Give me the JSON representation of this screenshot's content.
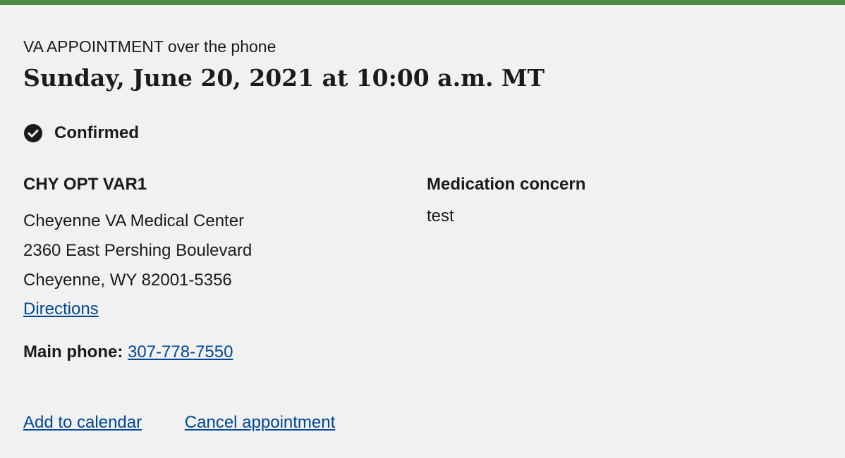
{
  "appointment": {
    "type_label": "VA APPOINTMENT over the phone",
    "datetime": "Sunday, June 20, 2021 at 10:00 a.m. MT",
    "status": "Confirmed"
  },
  "location": {
    "clinic": "CHY OPT VAR1",
    "facility": "Cheyenne VA Medical Center",
    "street": "2360 East Pershing Boulevard",
    "city_state_zip": "Cheyenne, WY 82001-5356",
    "directions_label": "Directions"
  },
  "reason": {
    "heading": "Medication concern",
    "detail": "test"
  },
  "phone": {
    "label": "Main phone:",
    "number": "307-778-7550"
  },
  "actions": {
    "add_calendar": "Add to calendar",
    "cancel": "Cancel appointment"
  },
  "colors": {
    "accent_border": "#4b8b47",
    "link": "#004795",
    "card_background": "#f1f1f1",
    "text": "#1b1b1b"
  },
  "icons": {
    "status": "check-circle-icon"
  }
}
